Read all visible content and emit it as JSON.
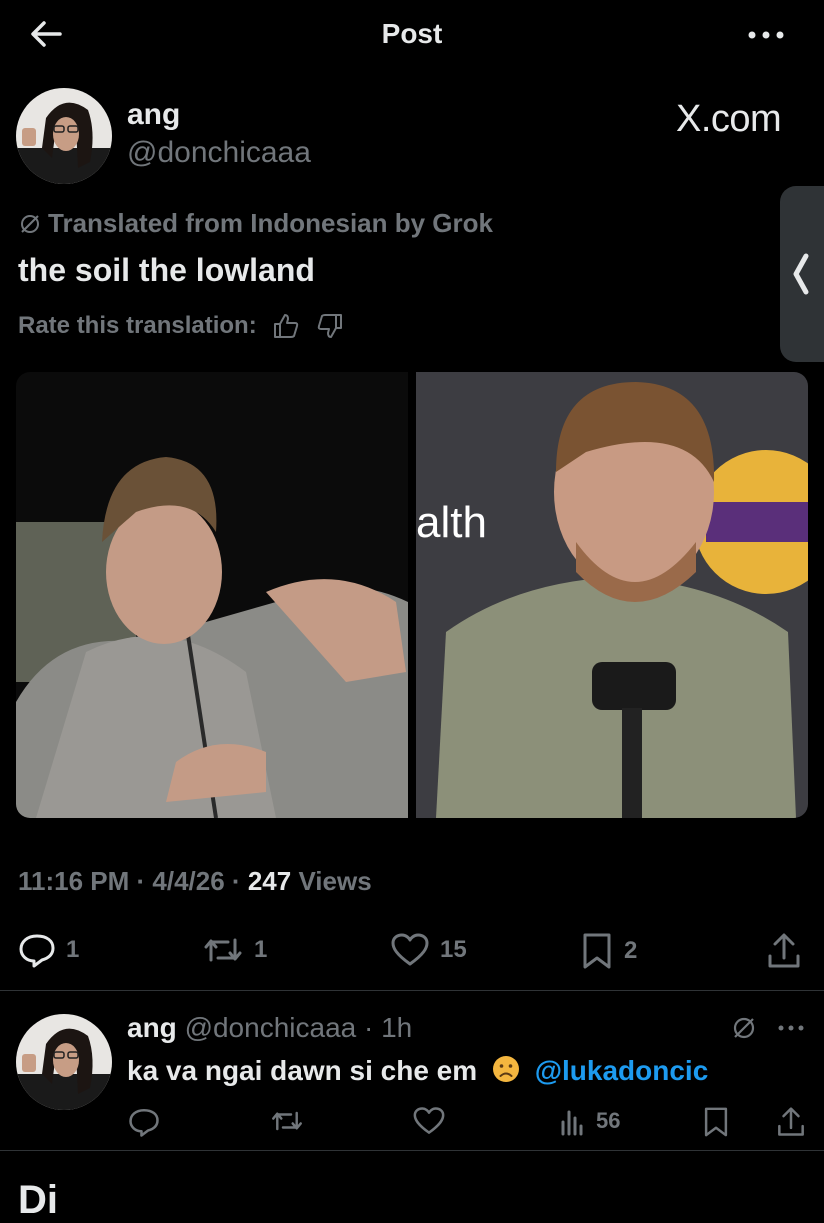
{
  "header": {
    "title": "Post"
  },
  "post": {
    "author_name": "ang",
    "author_handle": "@donchicaaa",
    "source_watermark": "X.com",
    "translation_notice": "Translated from Indonesian by Grok",
    "text": "the soil the lowland",
    "rate_label": "Rate this translation:",
    "time": "11:16 PM",
    "date": "4/4/26",
    "views_count": "247",
    "views_label": "Views",
    "stats": {
      "replies": "1",
      "reposts": "1",
      "likes": "15",
      "bookmarks": "2"
    }
  },
  "reply": {
    "author_name": "ang",
    "author_handle": "@donchicaaa",
    "age": "1h",
    "text": "ka va ngai dawn si che em",
    "mention": "@lukadoncic",
    "views": "56"
  },
  "bottom_cut_text": "Di",
  "colors": {
    "background": "#000000",
    "text": "#e7e9ea",
    "muted": "#71767b",
    "link": "#1d9bf0",
    "divider": "#2f3336"
  }
}
